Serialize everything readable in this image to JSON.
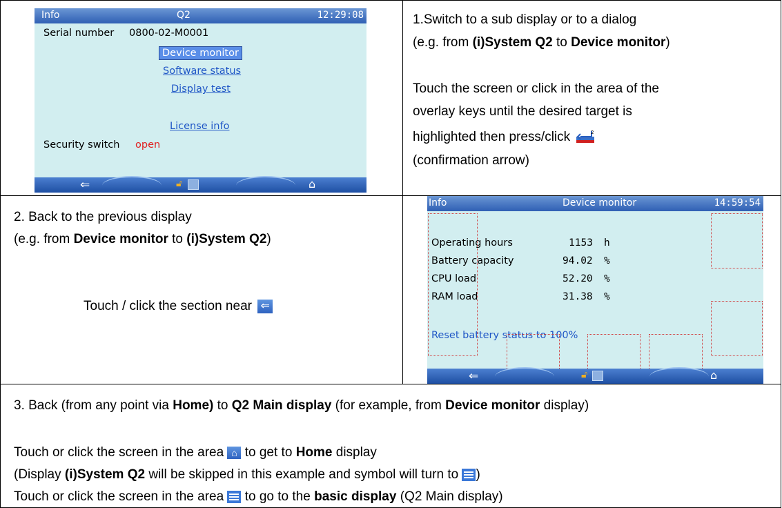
{
  "screen1": {
    "title_left": "Info",
    "title_center": "Q2",
    "clock": "12:29:08",
    "serial_label": "Serial number",
    "serial_value": "0800-02-M0001",
    "device_monitor": "Device monitor",
    "software_status": "Software status",
    "display_test": "Display test",
    "license_info": "License info",
    "security_label": "Security switch",
    "security_value": "open"
  },
  "row1": {
    "line1": "1.Switch to a sub display or to a dialog",
    "line2_pre": "(e.g. from ",
    "line2_b1": "(i)System Q2",
    "line2_mid": " to ",
    "line2_b2": "Device monitor",
    "line2_post": ")",
    "line3": "Touch the screen or click in the area of the",
    "line4": "overlay keys until the desired target is",
    "line5": "highlighted  then press/click",
    "line6": "(confirmation arrow)"
  },
  "row2": {
    "line1": "2. Back to the previous display",
    "line2_pre": "(e.g. from  ",
    "line2_b1": "Device monitor",
    "line2_mid": " to ",
    "line2_b2": "(i)System Q2",
    "line2_post": ")",
    "line3": "Touch / click the section near"
  },
  "screen2": {
    "title_left": "Info",
    "title_center": "Device monitor",
    "clock": "14:59:54",
    "rows": [
      {
        "label": "Operating hours",
        "value": "1153",
        "unit": "h"
      },
      {
        "label": "Battery capacity",
        "value": "94.02",
        "unit": "%"
      },
      {
        "label": "CPU load",
        "value": "52.20",
        "unit": "%"
      },
      {
        "label": "RAM load",
        "value": "31.38",
        "unit": "%"
      }
    ],
    "reset_link": "Reset battery status to 100%"
  },
  "row3": {
    "line1_pre": "3. Back (from any point via ",
    "line1_b1": "Home)",
    "line1_mid": " to ",
    "line1_b2": "Q2 Main display",
    "line1_mid2": " (for example, from ",
    "line1_b3": "Device monitor",
    "line1_post": " display)",
    "line2_pre": "Touch or click the screen in the area",
    "line2_mid": " to get to ",
    "line2_b": "Home",
    "line2_post": " display",
    "line3_pre": "(Display ",
    "line3_b": "(i)System Q2",
    "line3_post": " will be skipped in this example and symbol will turn to",
    "line3_end": ")",
    "line4_pre": "Touch or click the screen in the area",
    "line4_mid": " to go to the ",
    "line4_b": "basic display",
    "line4_post": " (Q2 Main display)"
  },
  "colors": {
    "screen_bg": "#d2eef0",
    "title_bar": "#2f5fb4",
    "link": "#1f56c6",
    "alert": "#e02020"
  },
  "icons": [
    "back-arrow-icon",
    "lock-icon",
    "monitor-icon",
    "home-icon",
    "enter-icon",
    "list-icon"
  ]
}
